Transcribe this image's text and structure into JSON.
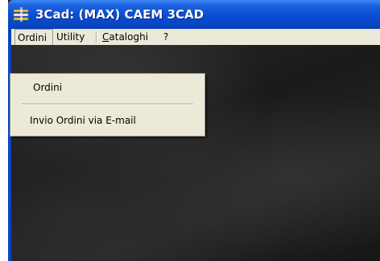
{
  "window": {
    "title": "3Cad: (MAX) CAEM 3CAD",
    "app_icon": "3cad-app-icon"
  },
  "menubar": {
    "items": [
      {
        "label": "Ordini",
        "open": true
      },
      {
        "label": "Utility"
      },
      {
        "label": "Cataloghi",
        "mnemonic": "C"
      },
      {
        "label": "?"
      }
    ],
    "cataloghi_mnemonic": "C",
    "cataloghi_rest": "ataloghi"
  },
  "dropdown": {
    "items": [
      {
        "label": "Ordini"
      },
      {
        "label": "Invio Ordini via E-mail"
      }
    ]
  },
  "colors": {
    "titlebar": "#0b4fd4",
    "menubar": "#ece9d8",
    "workspace": "#1c1c1c"
  }
}
